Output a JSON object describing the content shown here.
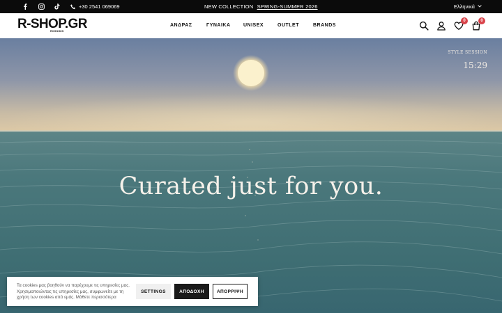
{
  "topbar": {
    "social": [
      {
        "icon": "facebook-icon",
        "glyph": "f"
      },
      {
        "icon": "instagram-icon",
        "glyph": "◎"
      },
      {
        "icon": "tiktok-icon",
        "glyph": "♪"
      }
    ],
    "phone": "+30 2541 069069",
    "announcement_prefix": "NEW COLLECTION",
    "announcement_link": "SPRING-SUMMER 2026",
    "language": "Ελληνικά"
  },
  "header": {
    "logo_text": "R-SHOP.GR",
    "logo_sub": "ROSSIDIS",
    "nav": [
      "ΑΝΔΡΑΣ",
      "ΓΥΝΑΙΚΑ",
      "UNISEX",
      "OUTLET",
      "BRANDS"
    ],
    "wishlist_count": "0",
    "cart_count": "0"
  },
  "hero": {
    "headline": "Curated just for you.",
    "session_label": "STYLE SESSION",
    "clock": "15:29"
  },
  "cookie": {
    "message": "Τα cookies μας βοηθούν να παρέχουμε τις υπηρεσίες μας. Χρησιμοποιώντας τις υπηρεσίες μας, συμφωνείτε με τη χρήση των cookies από εμάς. Μάθετε περισσότερα",
    "settings_label": "SETTINGS",
    "accept_label": "ΑΠΟΔΟΧΗ",
    "reject_label": "ΑΠΟΡΡΙΨΗ"
  },
  "colors": {
    "topbar_bg": "#0b0b0b",
    "badge": "#d9434a",
    "sea": "#3c6c72",
    "sky_top": "#6f82a3",
    "horizon": "#d9c8a8"
  }
}
